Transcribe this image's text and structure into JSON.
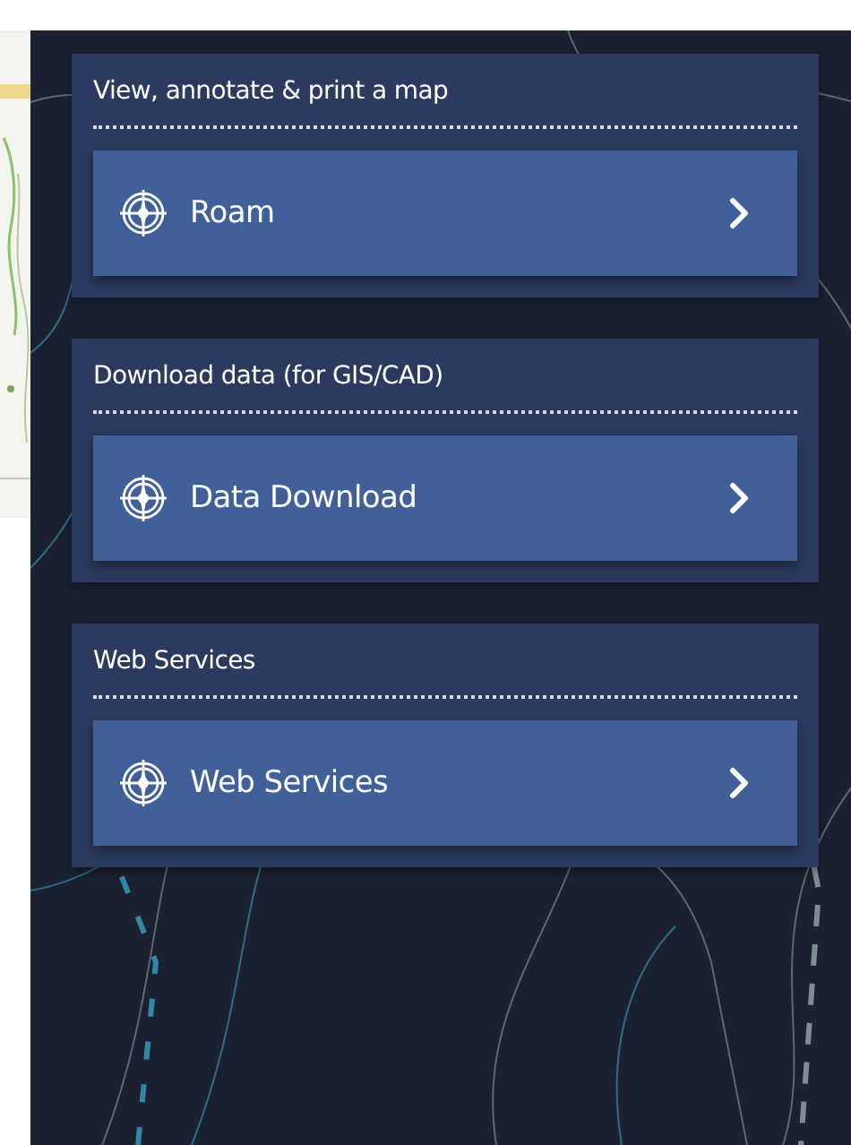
{
  "sections": [
    {
      "heading": "View, annotate & print a map",
      "button": {
        "label": "Roam"
      }
    },
    {
      "heading": "Download data (for GIS/CAD)",
      "button": {
        "label": "Data Download"
      }
    },
    {
      "heading": "Web Services",
      "button": {
        "label": "Web Services"
      }
    }
  ]
}
